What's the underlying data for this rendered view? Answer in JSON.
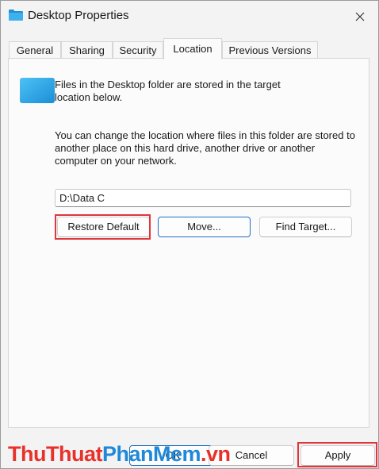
{
  "window": {
    "title": "Desktop Properties"
  },
  "tabs": [
    {
      "label": "General"
    },
    {
      "label": "Sharing"
    },
    {
      "label": "Security"
    },
    {
      "label": "Location",
      "active": true
    },
    {
      "label": "Previous Versions"
    }
  ],
  "location": {
    "info_text": "Files in the Desktop folder are stored in the target location below.",
    "description": "You can change the location where files in this folder are stored to another place on this hard drive, another drive or another computer on your network.",
    "path_value": "D:\\Data C",
    "restore_default_label": "Restore Default",
    "move_label": "Move...",
    "find_target_label": "Find Target..."
  },
  "footer": {
    "ok_label": "OK",
    "cancel_label": "Cancel",
    "apply_label": "Apply"
  },
  "watermark": {
    "part1": "ThuThuat",
    "part2": "PhanMem",
    "part3": ".vn"
  },
  "colors": {
    "highlight": "#e0353b",
    "primary_border": "#1f6fc5",
    "folder": "#29a0e0"
  },
  "icons": {
    "title": "folder-icon",
    "close": "close-icon",
    "location": "folder-icon"
  }
}
